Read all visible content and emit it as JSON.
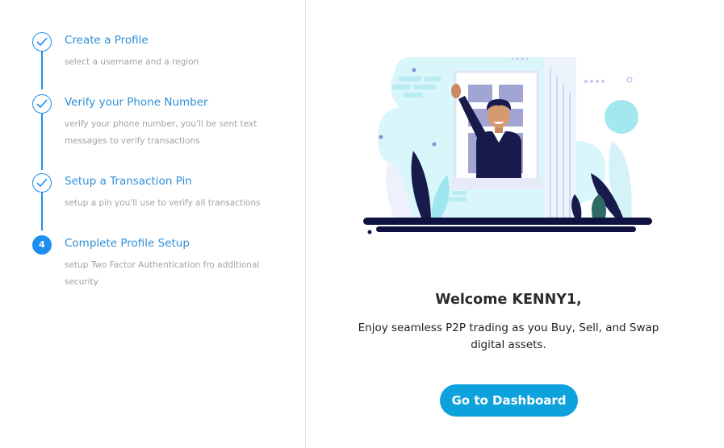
{
  "steps": [
    {
      "title": "Create a Profile",
      "desc": "select a username and a region",
      "status": "done"
    },
    {
      "title": "Verify your Phone Number",
      "desc": "verify your phone number, you'll be sent text messages to verify transactions",
      "status": "done"
    },
    {
      "title": "Setup a Transaction Pin",
      "desc": "setup a pin you'll use to verify all transactions",
      "status": "done"
    },
    {
      "title": "Complete Profile Setup",
      "desc": "setup Two Factor Authentication fro additional security",
      "status": "current",
      "number": "4"
    }
  ],
  "main": {
    "welcome": "Welcome KENNY1,",
    "tagline": "Enjoy seamless P2P trading as you Buy, Sell, and Swap digital assets.",
    "dashboard_button": "Go to Dashboard"
  },
  "colors": {
    "accent": "#1d8ff0",
    "button": "#0ea2dd",
    "step_title": "#2f8fd8"
  },
  "icons": {
    "done": "check-circle-icon",
    "illustration": "waving-man-window-illustration"
  }
}
